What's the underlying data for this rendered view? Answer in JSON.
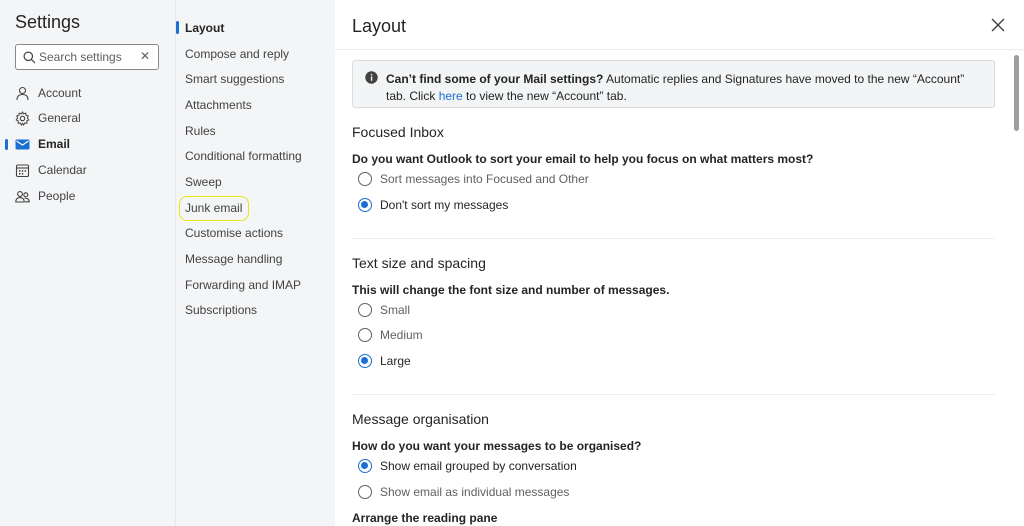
{
  "nav": {
    "title": "Settings",
    "search_placeholder": "Search settings",
    "items": [
      {
        "label": "Account",
        "icon": "person-icon"
      },
      {
        "label": "General",
        "icon": "gear-icon"
      },
      {
        "label": "Email",
        "icon": "mail-icon",
        "selected": true
      },
      {
        "label": "Calendar",
        "icon": "calendar-icon"
      },
      {
        "label": "People",
        "icon": "people-icon"
      }
    ]
  },
  "subnav": {
    "items": [
      {
        "label": "Layout",
        "selected": true
      },
      {
        "label": "Compose and reply"
      },
      {
        "label": "Smart suggestions"
      },
      {
        "label": "Attachments"
      },
      {
        "label": "Rules"
      },
      {
        "label": "Conditional formatting"
      },
      {
        "label": "Sweep"
      },
      {
        "label": "Junk email",
        "highlighted": true
      },
      {
        "label": "Customise actions"
      },
      {
        "label": "Message handling"
      },
      {
        "label": "Forwarding and IMAP"
      },
      {
        "label": "Subscriptions"
      }
    ]
  },
  "content": {
    "title": "Layout",
    "banner": {
      "bold": "Can’t find some of your Mail settings?",
      "text": " Automatic replies and Signatures have moved to the new “Account” tab. Click ",
      "link": "here",
      "text_after": " to view the new “Account” tab."
    },
    "focused_inbox": {
      "heading": "Focused Inbox",
      "question": "Do you want Outlook to sort your email to help you focus on what matters most?",
      "options": [
        "Sort messages into Focused and Other",
        "Don't sort my messages"
      ],
      "selected": 1
    },
    "text_size": {
      "heading": "Text size and spacing",
      "question": "This will change the font size and number of messages.",
      "options": [
        "Small",
        "Medium",
        "Large"
      ],
      "selected": 2
    },
    "organisation": {
      "heading": "Message organisation",
      "question": "How do you want your messages to be organised?",
      "options": [
        "Show email grouped by conversation",
        "Show email as individual messages"
      ],
      "selected": 0,
      "next_question": "Arrange the reading pane"
    }
  },
  "colors": {
    "accent": "#1a6fd0",
    "highlight_ring": "#e8e51a",
    "nav_background": "#f4f5f6"
  }
}
